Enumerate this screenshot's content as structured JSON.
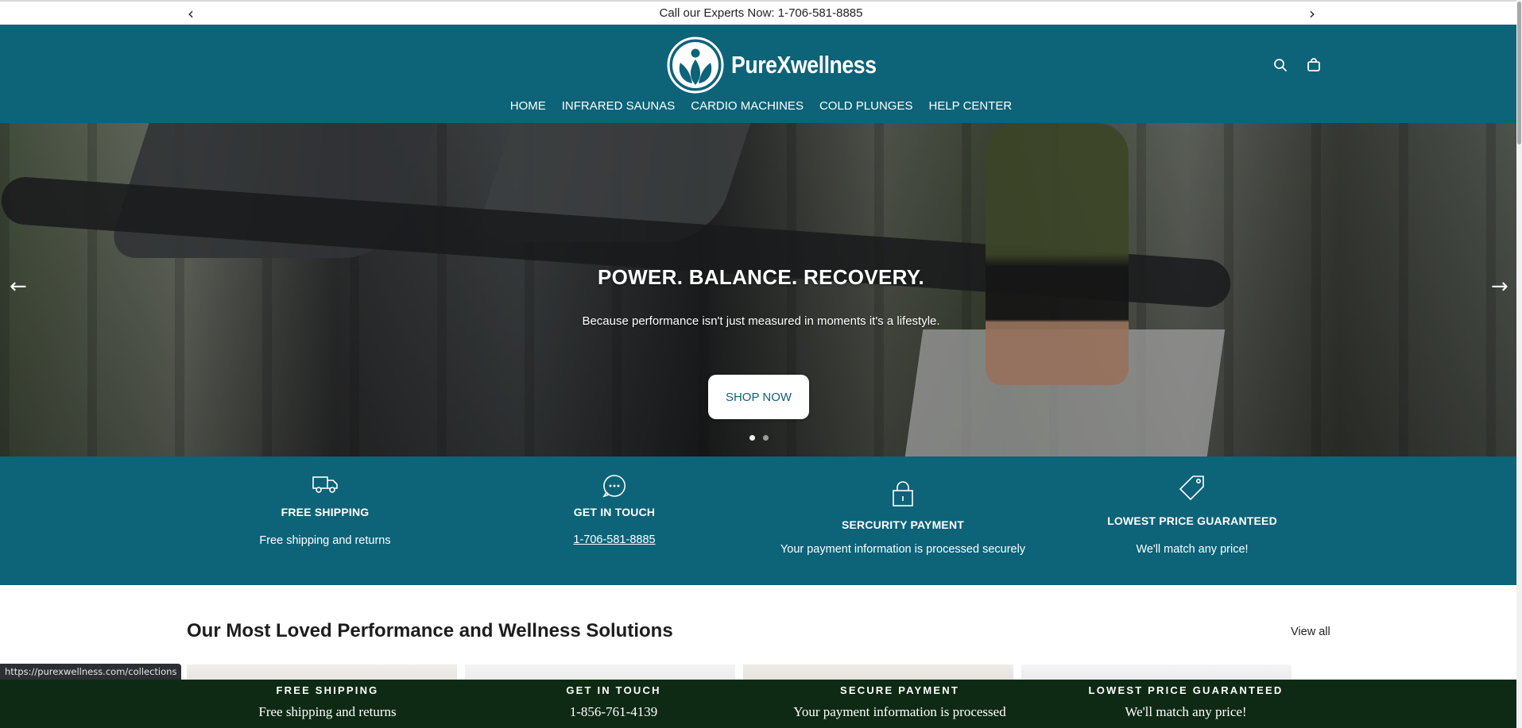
{
  "announcement": {
    "text": "Call our Experts Now: 1-706-581-8885",
    "prev_icon": "chevron-left-icon",
    "next_icon": "chevron-right-icon"
  },
  "header": {
    "brand": "PureXwellness",
    "logo_icon": "leaf-person-logo",
    "search_icon": "search-icon",
    "cart_icon": "shopping-bag-icon",
    "background": "#0d6378"
  },
  "nav": {
    "items": [
      {
        "label": "HOME"
      },
      {
        "label": "INFRARED SAUNAS"
      },
      {
        "label": "CARDIO MACHINES"
      },
      {
        "label": "COLD PLUNGES"
      },
      {
        "label": "HELP CENTER"
      }
    ]
  },
  "hero": {
    "title": "POWER. BALANCE. RECOVERY.",
    "subtitle": "Because performance isn't just measured in moments it's a lifestyle.",
    "button_label": "SHOP NOW",
    "slide_count": 2,
    "active_slide": 1
  },
  "features": [
    {
      "icon": "truck-icon",
      "title": "FREE SHIPPING",
      "description": "Free shipping and returns"
    },
    {
      "icon": "chat-bubble-icon",
      "title": "GET IN TOUCH",
      "link": "1-706-581-8885"
    },
    {
      "icon": "lock-icon",
      "title": "SERCURITY PAYMENT",
      "description": "Your payment information is processed securely"
    },
    {
      "icon": "price-tag-icon",
      "title": "LOWEST PRICE GUARANTEED",
      "description": "We'll match any price!"
    }
  ],
  "collection": {
    "title": "Our Most Loved Performance and Wellness Solutions",
    "view_all": "View all"
  },
  "status_url": "https://purexwellness.com/collections",
  "sticky_bar": [
    {
      "title": "FREE SHIPPING",
      "description": "Free shipping and returns"
    },
    {
      "title": "GET IN TOUCH",
      "description": "1-856-761-4139"
    },
    {
      "title": "SECURE PAYMENT",
      "description": "Your payment information is processed"
    },
    {
      "title": "LOWEST PRICE GUARANTEED",
      "description": "We'll match any price!"
    }
  ],
  "colors": {
    "brand_teal": "#0d6378",
    "sticky_green": "#0f2a14"
  }
}
